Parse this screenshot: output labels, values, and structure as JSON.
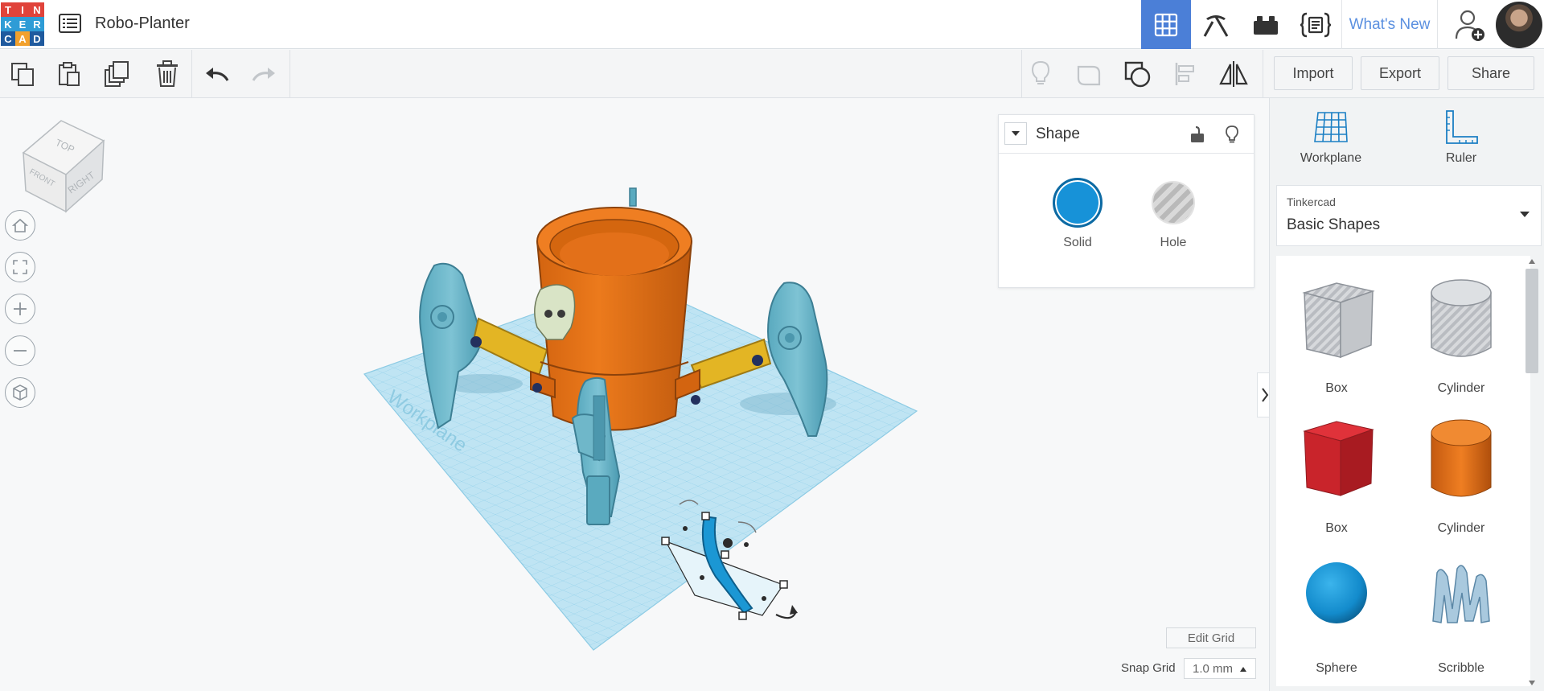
{
  "app": {
    "logo_letters": [
      "T",
      "I",
      "N",
      "K",
      "E",
      "R",
      "C",
      "A",
      "D"
    ],
    "logo_colors": [
      "#e0433a",
      "#e0433a",
      "#e0433a",
      "#2e9cd6",
      "#2e9cd6",
      "#2e9cd6",
      "#1f5a9e",
      "#f2a12d",
      "#1f5a9e"
    ],
    "design_title": "Robo-Planter",
    "whats_new": "What's New",
    "accent": "#4b7fd7"
  },
  "header": {
    "buttons": [
      {
        "name": "3d-view-icon",
        "active": true
      },
      {
        "name": "pickaxe-icon",
        "active": false
      },
      {
        "name": "bricks-icon",
        "active": false
      },
      {
        "name": "codeblocks-icon",
        "active": false
      }
    ]
  },
  "toolbar": {
    "import_label": "Import",
    "export_label": "Export",
    "share_label": "Share"
  },
  "viewcube": {
    "top": "TOP",
    "front": "FRONT",
    "right": "RIGHT"
  },
  "workplane_watermark": "Workplane",
  "inspector": {
    "title": "Shape",
    "solid_label": "Solid",
    "hole_label": "Hole",
    "solid_color": "#1792d8"
  },
  "grid": {
    "edit_label": "Edit Grid",
    "snap_label": "Snap Grid",
    "snap_value": "1.0 mm"
  },
  "rightpanel": {
    "workplane_label": "Workplane",
    "ruler_label": "Ruler",
    "library_small": "Tinkercad",
    "library_main": "Basic Shapes",
    "shapes": [
      {
        "label": "Box",
        "type": "box-hole"
      },
      {
        "label": "Cylinder",
        "type": "cylinder-hole"
      },
      {
        "label": "Box",
        "type": "box-red"
      },
      {
        "label": "Cylinder",
        "type": "cylinder-orange"
      },
      {
        "label": "Sphere",
        "type": "sphere-blue"
      },
      {
        "label": "Scribble",
        "type": "scribble"
      }
    ]
  }
}
